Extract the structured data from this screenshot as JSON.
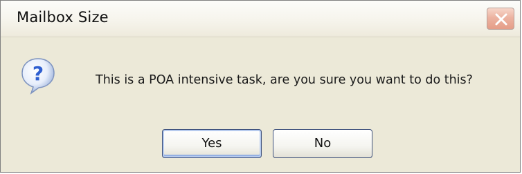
{
  "window": {
    "title": "Mailbox Size",
    "close_icon": "close-icon"
  },
  "dialog": {
    "icon": "question-icon",
    "message": "This is a POA intensive task, are you sure you want to do this?"
  },
  "buttons": {
    "yes_label": "Yes",
    "no_label": "No"
  },
  "colors": {
    "dialog_background": "#ece9d8",
    "close_button": "#e59d88",
    "question_icon_blue": "#2f5fd0"
  }
}
